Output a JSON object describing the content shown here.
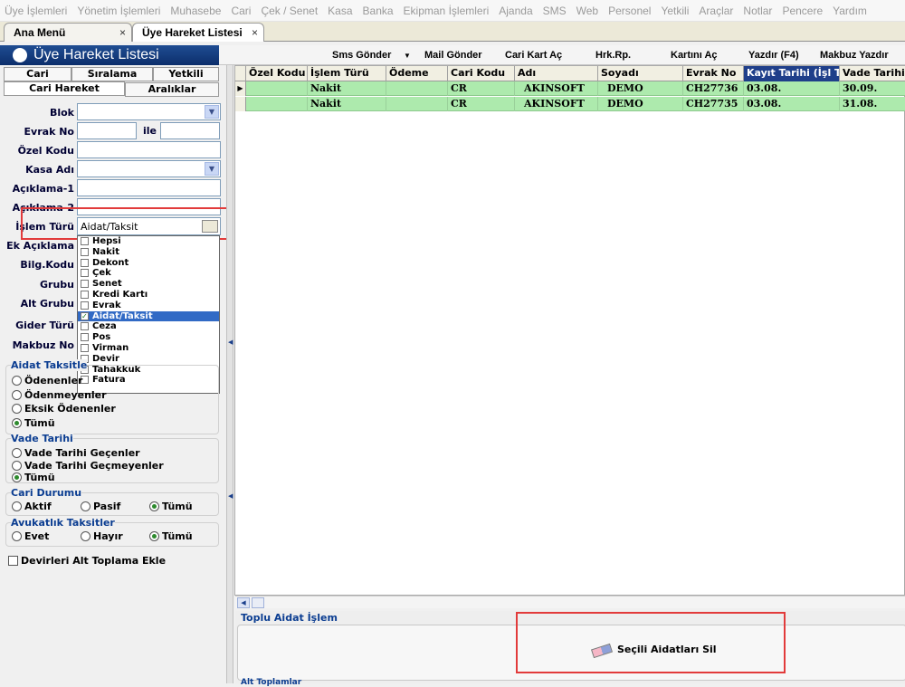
{
  "menubar": [
    "Üye İşlemleri",
    "Yönetim İşlemleri",
    "Muhasebe",
    "Cari",
    "Çek / Senet",
    "Kasa",
    "Banka",
    "Ekipman İşlemleri",
    "Ajanda",
    "SMS",
    "Web",
    "Personel",
    "Yetkili",
    "Araçlar",
    "Notlar",
    "Pencere",
    "Yardım"
  ],
  "tabs": [
    {
      "label": "Ana Menü",
      "close": "×"
    },
    {
      "label": "Üye Hareket Listesi",
      "close": "×"
    }
  ],
  "window_title": "Üye Hareket Listesi",
  "toolbar": {
    "sms": "Sms Gönder",
    "sms_arrow": "▼",
    "mail": "Mail Gönder",
    "cari_kart": "Cari Kart Aç",
    "hrk_rp": "Hrk.Rp.",
    "kartini_ac": "Kartını Aç",
    "yazdir": "Yazdır (F4)",
    "makbuz": "Makbuz Yazdır"
  },
  "left_tabs": {
    "row1": [
      "Cari",
      "Sıralama",
      "Yetkili"
    ],
    "row2": [
      "Cari Hareket",
      "Aralıklar"
    ]
  },
  "fields": {
    "blok": "Blok",
    "evrak_no": "Evrak No",
    "ile": "ile",
    "ozel_kodu": "Özel Kodu",
    "kasa_adi": "Kasa Adı",
    "aciklama1": "Açıklama-1",
    "aciklama2": "Açıklama-2",
    "islem_turu": "İşlem Türü",
    "islem_turu_value": "Aidat/Taksit",
    "ek_aciklama": "Ek Açıklama",
    "bilg_kodu": "Bilg.Kodu",
    "grubu": "Grubu",
    "alt_grubu": "Alt Grubu",
    "gider_turu": "Gider Türü",
    "makbuz_no": "Makbuz No"
  },
  "dropdown_items": [
    {
      "label": "Hepsi",
      "checked": false
    },
    {
      "label": "Nakit",
      "checked": false
    },
    {
      "label": "Dekont",
      "checked": false
    },
    {
      "label": "Çek",
      "checked": false
    },
    {
      "label": "Senet",
      "checked": false
    },
    {
      "label": "Kredi Kartı",
      "checked": false
    },
    {
      "label": "Evrak",
      "checked": false
    },
    {
      "label": "Aidat/Taksit",
      "checked": true
    },
    {
      "label": "Ceza",
      "checked": false
    },
    {
      "label": "Pos",
      "checked": false
    },
    {
      "label": "Virman",
      "checked": false
    },
    {
      "label": "Devir",
      "checked": false
    },
    {
      "label": "Tahakkuk",
      "checked": false
    },
    {
      "label": "Fatura",
      "checked": false
    }
  ],
  "aidat_group": {
    "title": "Aidat Taksitle",
    "options": [
      "Ödenenler",
      "Ödenmeyenler",
      "Eksik Ödenenler",
      "Tümü"
    ],
    "selected": "Tümü"
  },
  "vade_group": {
    "title": "Vade Tarihi",
    "options": [
      "Vade Tarihi Geçenler",
      "Vade Tarihi Geçmeyenler",
      "Tümü"
    ],
    "selected": "Tümü"
  },
  "cari_group": {
    "title": "Cari Durumu",
    "options": [
      "Aktif",
      "Pasif",
      "Tümü"
    ],
    "selected": "Tümü"
  },
  "avukat_group": {
    "title": "Avukatlık Taksitler",
    "options": [
      "Evet",
      "Hayır",
      "Tümü"
    ],
    "selected": "Tümü"
  },
  "devir_check": "Devirleri Alt Toplama Ekle",
  "grid": {
    "columns": [
      "Özel Kodu",
      "İşlem Türü",
      "Ödeme",
      "Cari Kodu",
      "Adı",
      "Soyadı",
      "Evrak No",
      "Kayıt Tarihi (İşl Tar)",
      "Vade Tarihi"
    ],
    "rows": [
      [
        "",
        "Nakit",
        "",
        "CR",
        "AKINSOFT",
        "DEMO",
        "CH27736",
        "03.08.",
        "30.09."
      ],
      [
        "",
        "Nakit",
        "",
        "CR",
        "AKINSOFT",
        "DEMO",
        "CH27735",
        "03.08.",
        "31.08."
      ]
    ]
  },
  "bottom": {
    "title": "Toplu Aidat İşlem",
    "button": "Seçili Aidatları Sil",
    "stub": "Alt Toplamlar"
  },
  "colors": {
    "accent": "#0c2e6b",
    "row": "#adeaad",
    "highlight": "#e23b3b"
  }
}
